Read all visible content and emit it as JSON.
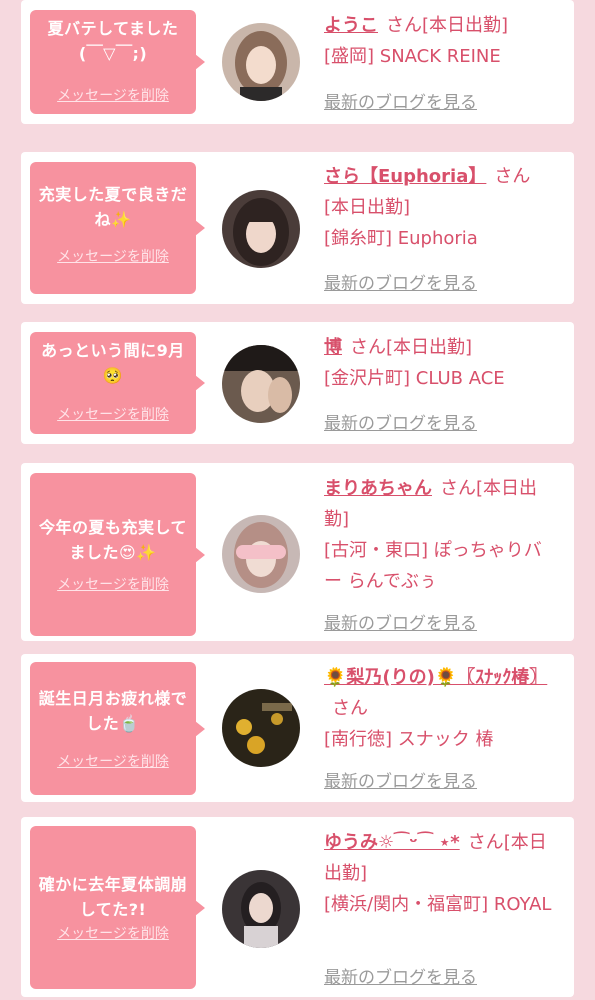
{
  "colors": {
    "background": "#f6d9df",
    "bubble": "#f7929f",
    "accent": "#d8506b",
    "link_gray": "#9a9a9a"
  },
  "cards": [
    {
      "message": "夏バテしてました(￣▽￣;)",
      "delete_label": "メッセージを削除",
      "name": "ようこ",
      "san": "さん",
      "status": "[本日出勤]",
      "shop": "[盛岡] SNACK REINE",
      "blog_label": "最新のブログを見る"
    },
    {
      "message": "充実した夏で良きだね✨",
      "delete_label": "メッセージを削除",
      "name": "さら【Euphoria】",
      "san": "さん",
      "status": "[本日出勤]",
      "shop": "[錦糸町] Euphoria",
      "blog_label": "最新のブログを見る"
    },
    {
      "message": "あっという間に9月🥺",
      "delete_label": "メッセージを削除",
      "name": "博",
      "san": "さん",
      "status": "[本日出勤]",
      "shop": "[金沢片町] CLUB ACE",
      "blog_label": "最新のブログを見る"
    },
    {
      "message": "今年の夏も充実してました😍✨",
      "delete_label": "メッセージを削除",
      "name": "まりあちゃん",
      "san": "さん",
      "status": "[本日出勤]",
      "shop": "[古河・東口] ぽっちゃりバー らんでぶぅ",
      "blog_label": "最新のブログを見る"
    },
    {
      "message": "誕生日月お疲れ様でした🍵",
      "delete_label": "メッセージを削除",
      "name": "🌻梨乃(りの)🌻〖ｽﾅｯｸ椿〗",
      "san": "さん",
      "status": "",
      "shop": "[南行徳] スナック 椿",
      "blog_label": "最新のブログを見る"
    },
    {
      "message": "確かに去年夏体調崩してた?!",
      "delete_label": "メッセージを削除",
      "name": "ゆうみ☼︎⁀ᵕ⁀ ⋆*",
      "san": "さん",
      "status": "[本日出勤]",
      "shop": "[横浜/関内・福富町] ROYAL",
      "blog_label": "最新のブログを見る"
    }
  ]
}
